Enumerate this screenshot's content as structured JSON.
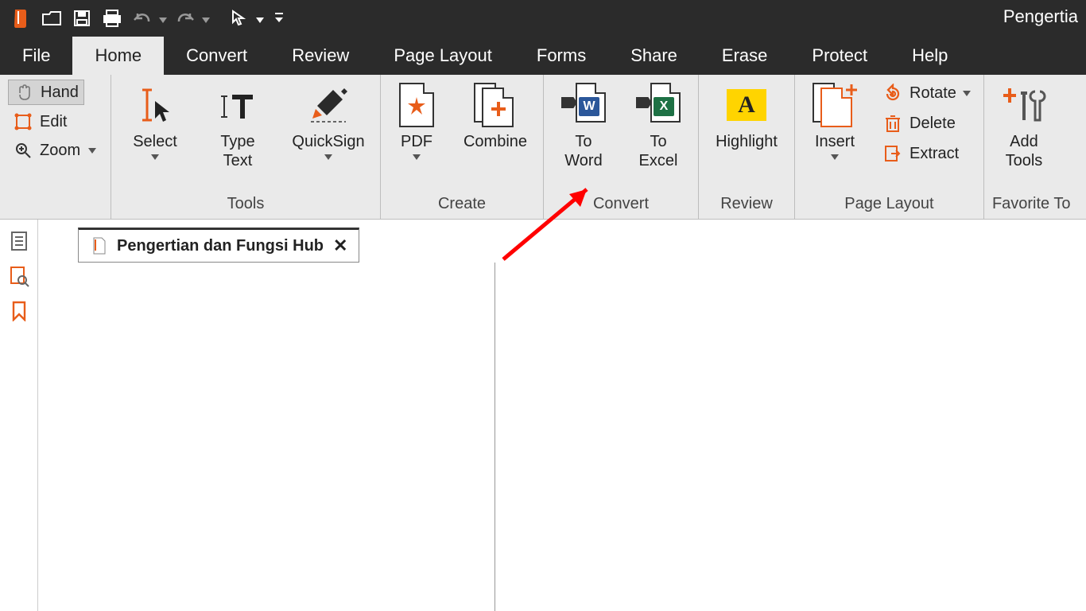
{
  "window_title": "Pengertia",
  "menubar": {
    "items": [
      "File",
      "Home",
      "Convert",
      "Review",
      "Page Layout",
      "Forms",
      "Share",
      "Erase",
      "Protect",
      "Help"
    ],
    "active_index": 1
  },
  "ribbon": {
    "left_tools": {
      "hand": "Hand",
      "edit": "Edit",
      "zoom": "Zoom"
    },
    "groups": [
      {
        "title": "Tools",
        "items": [
          {
            "label": "Select",
            "has_dropdown": true
          },
          {
            "label": "Type Text",
            "has_dropdown": false
          },
          {
            "label": "QuickSign",
            "has_dropdown": true
          }
        ]
      },
      {
        "title": "Create",
        "items": [
          {
            "label": "PDF",
            "has_dropdown": true
          },
          {
            "label": "Combine",
            "has_dropdown": false
          }
        ]
      },
      {
        "title": "Convert",
        "items": [
          {
            "label": "To Word",
            "has_dropdown": false
          },
          {
            "label": "To Excel",
            "has_dropdown": false
          }
        ]
      },
      {
        "title": "Review",
        "items": [
          {
            "label": "Highlight",
            "has_dropdown": false
          }
        ]
      },
      {
        "title": "Page Layout",
        "big": {
          "label": "Insert",
          "has_dropdown": true
        },
        "small_items": [
          {
            "label": "Rotate",
            "has_dropdown": true
          },
          {
            "label": "Delete",
            "has_dropdown": false
          },
          {
            "label": "Extract",
            "has_dropdown": false
          }
        ]
      },
      {
        "title": "Favorite To",
        "items": [
          {
            "label": "Add Tools",
            "has_dropdown": false
          }
        ]
      }
    ]
  },
  "document_tab": {
    "title": "Pengertian dan Fungsi Hub"
  }
}
